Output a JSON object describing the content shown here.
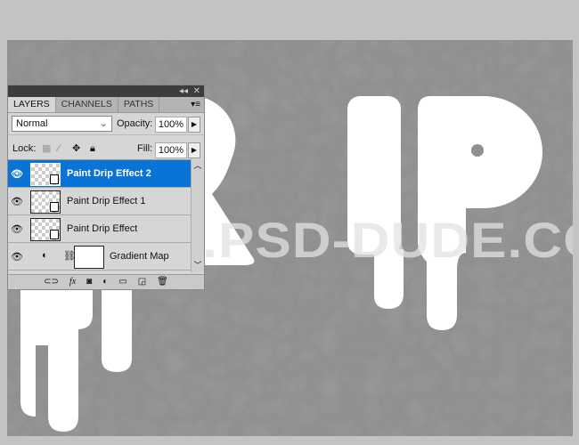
{
  "panel": {
    "tabs": [
      "LAYERS",
      "CHANNELS",
      "PATHS"
    ],
    "blend_mode": "Normal",
    "opacity_label": "Opacity:",
    "opacity": "100%",
    "lock_label": "Lock:",
    "fill_label": "Fill:",
    "fill": "100%",
    "layers": [
      {
        "name": "Paint Drip Effect 2",
        "selected": true
      },
      {
        "name": "Paint Drip Effect 1"
      },
      {
        "name": "Paint Drip Effect"
      },
      {
        "name": "Gradient Map"
      }
    ]
  },
  "canvas": {
    "watermark": "WWW.PSD-DUDE.COM",
    "text_color": "#ffffff",
    "background_color": "#8d8d8d"
  },
  "accent": "#0a74d6"
}
